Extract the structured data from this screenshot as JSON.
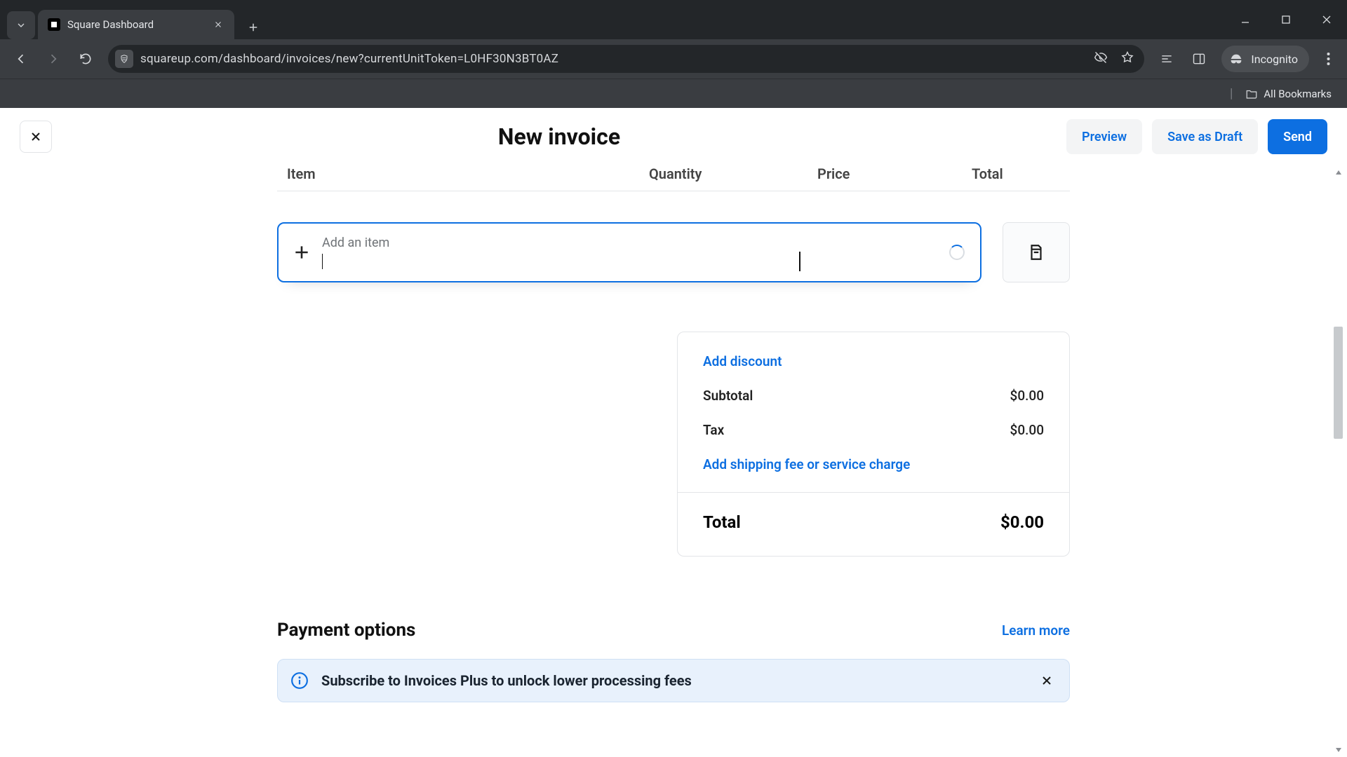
{
  "browser": {
    "tab_title": "Square Dashboard",
    "url": "squareup.com/dashboard/invoices/new?currentUnitToken=L0HF30N3BT0AZ",
    "incognito_label": "Incognito",
    "bookmarks_label": "All Bookmarks"
  },
  "header": {
    "title": "New invoice",
    "preview_label": "Preview",
    "draft_label": "Save as Draft",
    "send_label": "Send"
  },
  "columns": {
    "item": "Item",
    "quantity": "Quantity",
    "price": "Price",
    "total": "Total"
  },
  "add_item": {
    "label": "Add an item",
    "value": ""
  },
  "summary": {
    "add_discount": "Add discount",
    "subtotal_label": "Subtotal",
    "subtotal_value": "$0.00",
    "tax_label": "Tax",
    "tax_value": "$0.00",
    "shipping_link": "Add shipping fee or service charge",
    "total_label": "Total",
    "total_value": "$0.00"
  },
  "payment": {
    "heading": "Payment options",
    "learn_more": "Learn more",
    "banner_text": "Subscribe to Invoices Plus to unlock lower processing fees"
  },
  "colors": {
    "primary": "#0d6fe1"
  }
}
